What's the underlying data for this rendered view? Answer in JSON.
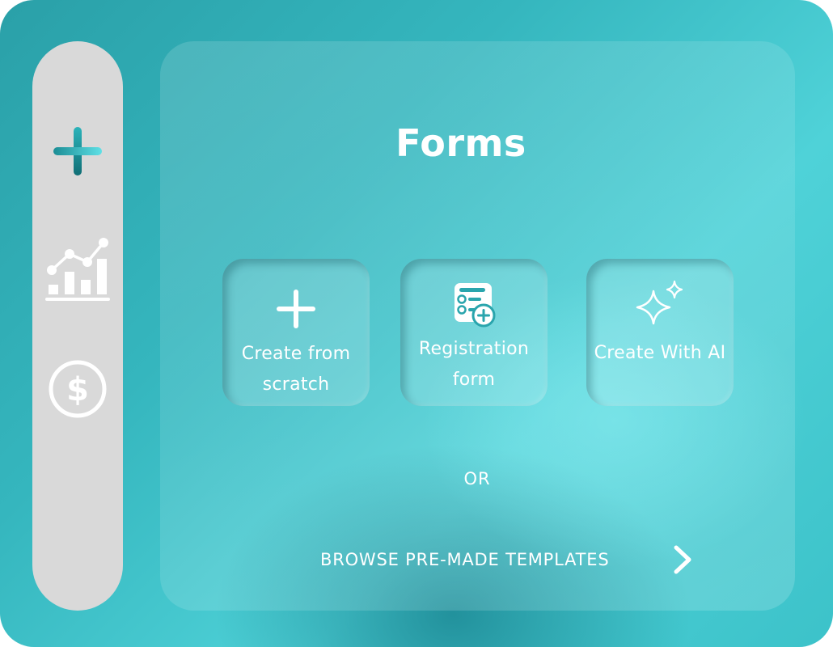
{
  "page": {
    "title": "Forms",
    "or_label": "OR",
    "browse_label": "BROWSE PRE-MADE TEMPLATES"
  },
  "sidebar": {
    "items": [
      {
        "name": "create",
        "icon": "plus-icon"
      },
      {
        "name": "analytics",
        "icon": "chart-icon"
      },
      {
        "name": "billing",
        "icon": "dollar-icon"
      }
    ]
  },
  "cards": [
    {
      "line1": "Create from",
      "line2": "scratch",
      "icon": "plus-icon"
    },
    {
      "line1": "Registration",
      "line2": "form",
      "icon": "registration-form-icon"
    },
    {
      "line1": "Create With AI",
      "icon": "sparkle-icon"
    }
  ],
  "colors": {
    "sidebar_bg": "#d9d9d9",
    "accent_teal": "#1f8f97",
    "accent_light": "#53d8de",
    "text": "#ffffff"
  }
}
